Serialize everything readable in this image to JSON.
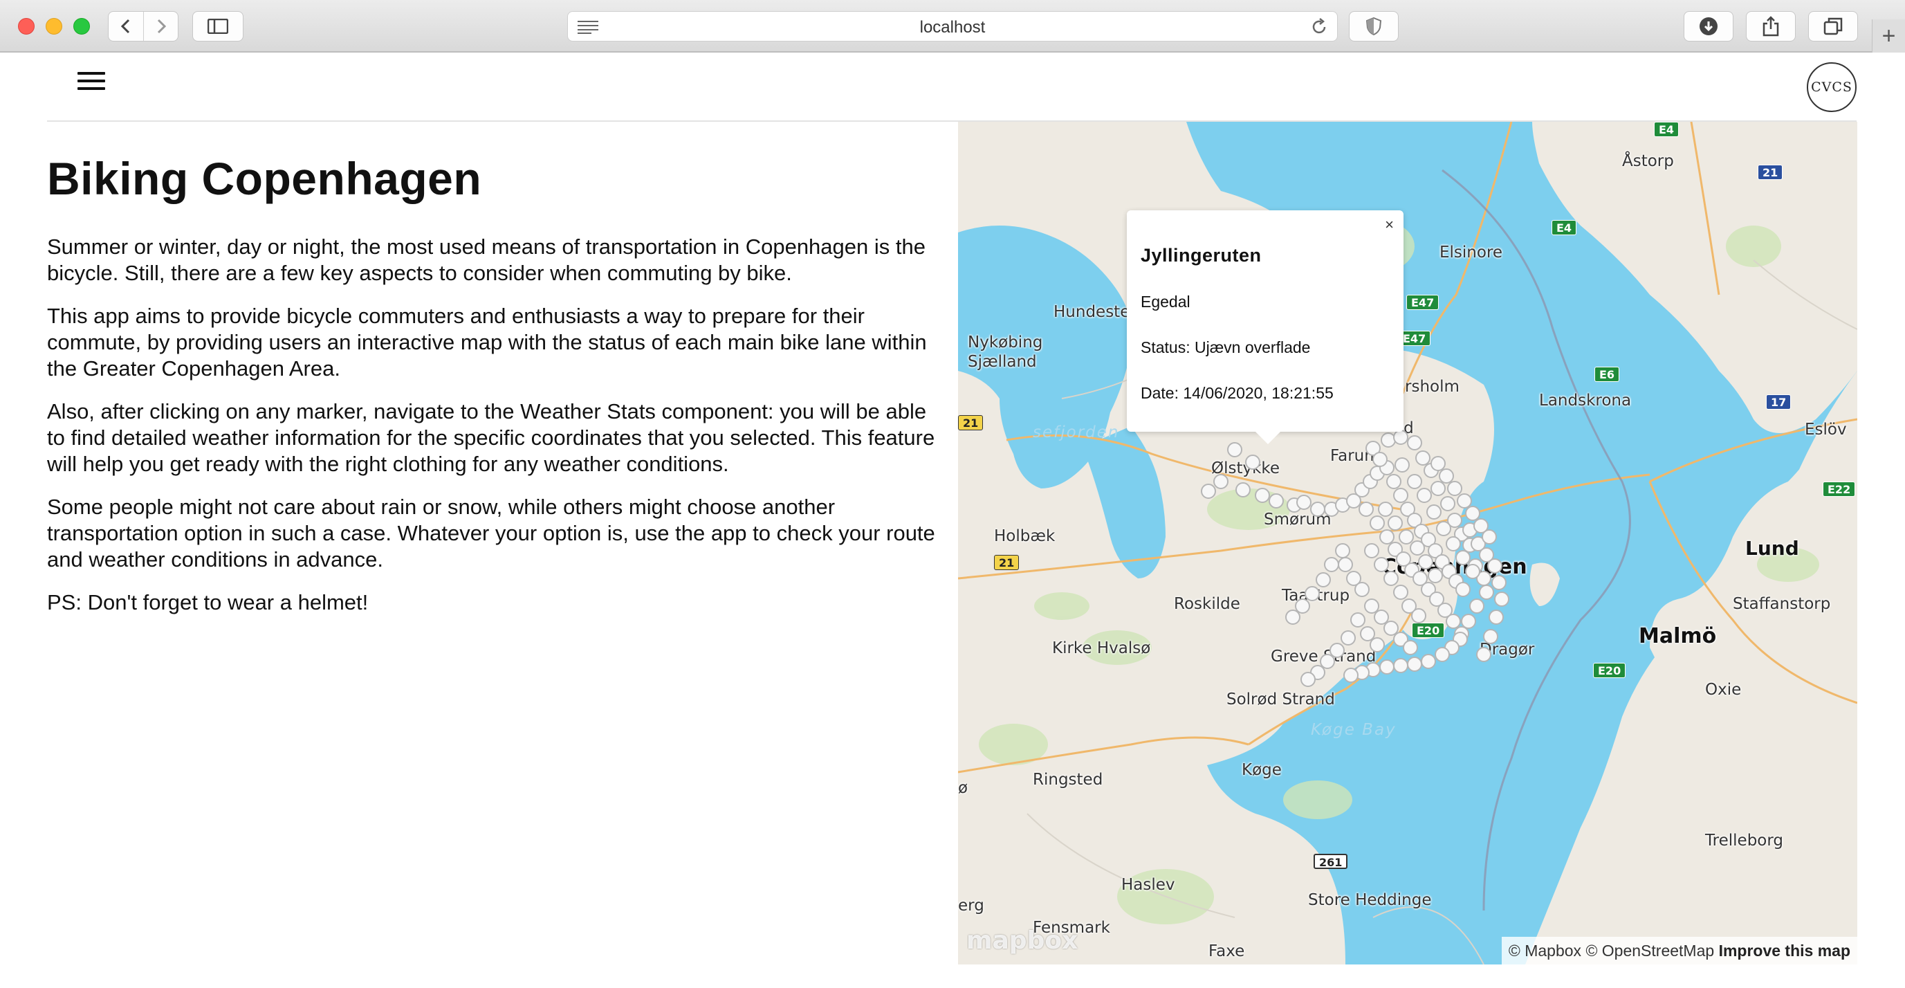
{
  "browser": {
    "address": "localhost"
  },
  "app": {
    "logo_text": "CVCS"
  },
  "article": {
    "title": "Biking Copenhagen",
    "paragraphs": [
      "Summer or winter, day or night, the most used means of transportation in Copenhagen is the bicycle. Still, there are a few key aspects to consider when commuting by bike.",
      "This app aims to provide bicycle commuters and enthusiasts a way to prepare for their commute, by providing users an interactive map with the status of each main bike lane within the Greater Copenhagen Area.",
      "Also, after clicking on any marker, navigate to the Weather Stats component: you will be able to find detailed weather information for the specific coordinates that you selected. This feature will help you get ready with the right clothing for any weather conditions.",
      "Some people might not care about rain or snow, while others might choose another transportation option in such a case. Whatever your option is, use the app to check your route and weather conditions in advance.",
      "PS: Don't forget to wear a helmet!"
    ]
  },
  "map": {
    "places": {
      "astorp": "Åstorp",
      "elsinore": "Elsinore",
      "hundested": "Hundeste",
      "nykobing_1": "Nykøbing",
      "nykobing_2": "Sjælland",
      "horsholm": "rsholm",
      "landskrona": "Landskrona",
      "eslov": "Eslöv",
      "isefjorden": "sefjorden",
      "olstykke": "Ølstykke",
      "farum": "Farum",
      "fredensborg_frag": "ød",
      "holbaek": "Holbæk",
      "smorum": "Smørum",
      "copenhagen": "Copenhagen",
      "lund": "Lund",
      "roskilde": "Roskilde",
      "taastrup": "Taastrup",
      "staffanstorp": "Staffanstorp",
      "malmo": "Malmö",
      "kirke_hvalso": "Kirke Hvalsø",
      "greve": "Greve Strand",
      "dragor": "Dragør",
      "oxie": "Oxie",
      "solrod": "Solrød Strand",
      "koge_bay": "Køge Bay",
      "koge": "Køge",
      "ringsted": "Ringsted",
      "trelleborg": "Trelleborg",
      "haslev": "Haslev",
      "store_heddinge": "Store Heddinge",
      "fensmark": "Fensmark",
      "faxe": "Faxe",
      "left_frag_1": "ø",
      "left_frag_2": "erg"
    },
    "shields": {
      "e4_top": "E4",
      "r21_top": "21",
      "e4_mid": "E4",
      "e47_a": "E47",
      "e47_b": "E47",
      "e6": "E6",
      "r17": "17",
      "r21_left": "21",
      "e22": "E22",
      "r21_mid": "21",
      "e20_a": "E20",
      "e20_b": "E20",
      "r261": "261"
    },
    "popup": {
      "close": "×",
      "title": "Jyllingeruten",
      "place": "Egedal",
      "status": "Status: Ujævn overflade",
      "date": "Date: 14/06/2020, 18:21:55"
    },
    "logo": "mapbox",
    "attribution": {
      "mapbox": "© Mapbox",
      "osm": "© OpenStreetMap",
      "improve": "Improve this map"
    }
  }
}
